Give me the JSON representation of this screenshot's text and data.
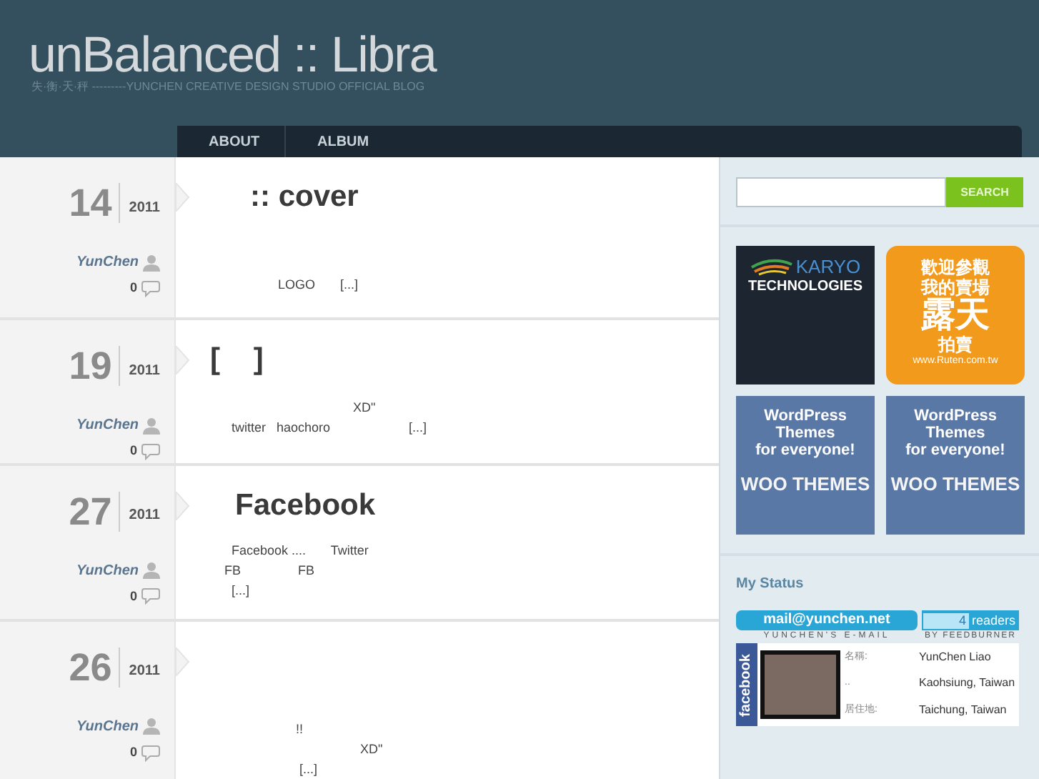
{
  "header": {
    "title": "unBalanced :: Libra",
    "tagline": "失·衡·天·秤 ---------YUNCHEN CREATIVE DESIGN STUDIO OFFICIAL BLOG"
  },
  "nav": [
    {
      "label": "ABOUT"
    },
    {
      "label": "ALBUM"
    }
  ],
  "posts": [
    {
      "day": "14",
      "year": "2011",
      "author": "YunChen",
      "comments": "0",
      "title": ":: cover",
      "lines": [
        "               LOGO       [...]"
      ]
    },
    {
      "day": "19",
      "year": "2011",
      "author": "YunChen",
      "comments": "0",
      "title": "[    ]",
      "lines": [
        "                                    XD\"",
        "  twitter   haochoro                      [...]"
      ]
    },
    {
      "day": "27",
      "year": "2011",
      "author": "YunChen",
      "comments": "0",
      "title": "   Facebook",
      "lines": [
        "  Facebook ....       Twitter",
        "FB                FB",
        "  [...]"
      ]
    },
    {
      "day": "26",
      "year": "2011",
      "author": "YunChen",
      "comments": "0",
      "lines": [
        "                    !!",
        "                                      XD\"",
        "                     [...]"
      ]
    }
  ],
  "sidebar": {
    "search_button": "SEARCH",
    "ads": [
      {
        "kind": "karyo",
        "lines": [
          "KARYO",
          "TECHNOLOGIES"
        ]
      },
      {
        "kind": "ruten",
        "lines": [
          "歡迎參觀",
          "我的賣場",
          "露天",
          "拍賣",
          "www.Ruten.com.tw"
        ]
      },
      {
        "kind": "woo",
        "lines": [
          "WordPress",
          "Themes",
          "for everyone!",
          "WOO THEMES"
        ]
      },
      {
        "kind": "woo",
        "lines": [
          "WordPress",
          "Themes",
          "for everyone!",
          "WOO THEMES"
        ]
      }
    ],
    "status_title": "My Status",
    "email": "mail@yunchen.net",
    "email_caption": "YUNCHEN'S E-MAIL",
    "readers_count": "4",
    "readers_label": "readers",
    "readers_caption": "BY FEEDBURNER",
    "facebook": {
      "brand": "facebook",
      "fields": [
        {
          "label": "名稱:",
          "value": "YunChen Liao"
        },
        {
          "label": "..",
          "value": "Kaohsiung, Taiwan"
        },
        {
          "label": "居住地:",
          "value": "Taichung, Taiwan"
        }
      ]
    }
  }
}
